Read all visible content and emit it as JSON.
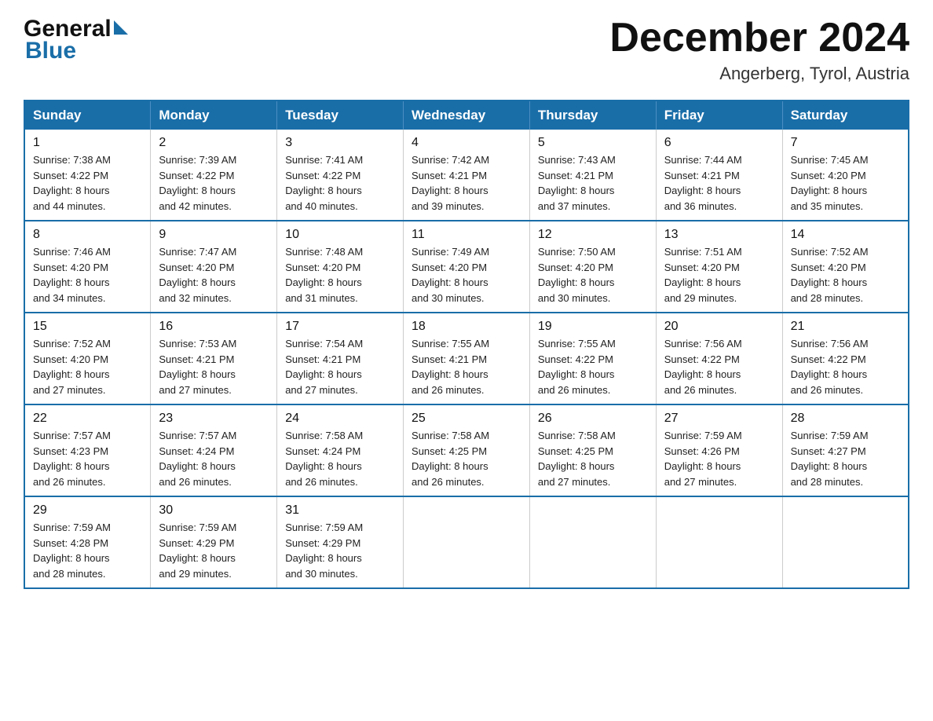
{
  "header": {
    "logo_general": "General",
    "logo_blue": "Blue",
    "month_title": "December 2024",
    "location": "Angerberg, Tyrol, Austria"
  },
  "days_of_week": [
    "Sunday",
    "Monday",
    "Tuesday",
    "Wednesday",
    "Thursday",
    "Friday",
    "Saturday"
  ],
  "weeks": [
    [
      {
        "day": "1",
        "sunrise": "7:38 AM",
        "sunset": "4:22 PM",
        "daylight": "8 hours and 44 minutes."
      },
      {
        "day": "2",
        "sunrise": "7:39 AM",
        "sunset": "4:22 PM",
        "daylight": "8 hours and 42 minutes."
      },
      {
        "day": "3",
        "sunrise": "7:41 AM",
        "sunset": "4:22 PM",
        "daylight": "8 hours and 40 minutes."
      },
      {
        "day": "4",
        "sunrise": "7:42 AM",
        "sunset": "4:21 PM",
        "daylight": "8 hours and 39 minutes."
      },
      {
        "day": "5",
        "sunrise": "7:43 AM",
        "sunset": "4:21 PM",
        "daylight": "8 hours and 37 minutes."
      },
      {
        "day": "6",
        "sunrise": "7:44 AM",
        "sunset": "4:21 PM",
        "daylight": "8 hours and 36 minutes."
      },
      {
        "day": "7",
        "sunrise": "7:45 AM",
        "sunset": "4:20 PM",
        "daylight": "8 hours and 35 minutes."
      }
    ],
    [
      {
        "day": "8",
        "sunrise": "7:46 AM",
        "sunset": "4:20 PM",
        "daylight": "8 hours and 34 minutes."
      },
      {
        "day": "9",
        "sunrise": "7:47 AM",
        "sunset": "4:20 PM",
        "daylight": "8 hours and 32 minutes."
      },
      {
        "day": "10",
        "sunrise": "7:48 AM",
        "sunset": "4:20 PM",
        "daylight": "8 hours and 31 minutes."
      },
      {
        "day": "11",
        "sunrise": "7:49 AM",
        "sunset": "4:20 PM",
        "daylight": "8 hours and 30 minutes."
      },
      {
        "day": "12",
        "sunrise": "7:50 AM",
        "sunset": "4:20 PM",
        "daylight": "8 hours and 30 minutes."
      },
      {
        "day": "13",
        "sunrise": "7:51 AM",
        "sunset": "4:20 PM",
        "daylight": "8 hours and 29 minutes."
      },
      {
        "day": "14",
        "sunrise": "7:52 AM",
        "sunset": "4:20 PM",
        "daylight": "8 hours and 28 minutes."
      }
    ],
    [
      {
        "day": "15",
        "sunrise": "7:52 AM",
        "sunset": "4:20 PM",
        "daylight": "8 hours and 27 minutes."
      },
      {
        "day": "16",
        "sunrise": "7:53 AM",
        "sunset": "4:21 PM",
        "daylight": "8 hours and 27 minutes."
      },
      {
        "day": "17",
        "sunrise": "7:54 AM",
        "sunset": "4:21 PM",
        "daylight": "8 hours and 27 minutes."
      },
      {
        "day": "18",
        "sunrise": "7:55 AM",
        "sunset": "4:21 PM",
        "daylight": "8 hours and 26 minutes."
      },
      {
        "day": "19",
        "sunrise": "7:55 AM",
        "sunset": "4:22 PM",
        "daylight": "8 hours and 26 minutes."
      },
      {
        "day": "20",
        "sunrise": "7:56 AM",
        "sunset": "4:22 PM",
        "daylight": "8 hours and 26 minutes."
      },
      {
        "day": "21",
        "sunrise": "7:56 AM",
        "sunset": "4:22 PM",
        "daylight": "8 hours and 26 minutes."
      }
    ],
    [
      {
        "day": "22",
        "sunrise": "7:57 AM",
        "sunset": "4:23 PM",
        "daylight": "8 hours and 26 minutes."
      },
      {
        "day": "23",
        "sunrise": "7:57 AM",
        "sunset": "4:24 PM",
        "daylight": "8 hours and 26 minutes."
      },
      {
        "day": "24",
        "sunrise": "7:58 AM",
        "sunset": "4:24 PM",
        "daylight": "8 hours and 26 minutes."
      },
      {
        "day": "25",
        "sunrise": "7:58 AM",
        "sunset": "4:25 PM",
        "daylight": "8 hours and 26 minutes."
      },
      {
        "day": "26",
        "sunrise": "7:58 AM",
        "sunset": "4:25 PM",
        "daylight": "8 hours and 27 minutes."
      },
      {
        "day": "27",
        "sunrise": "7:59 AM",
        "sunset": "4:26 PM",
        "daylight": "8 hours and 27 minutes."
      },
      {
        "day": "28",
        "sunrise": "7:59 AM",
        "sunset": "4:27 PM",
        "daylight": "8 hours and 28 minutes."
      }
    ],
    [
      {
        "day": "29",
        "sunrise": "7:59 AM",
        "sunset": "4:28 PM",
        "daylight": "8 hours and 28 minutes."
      },
      {
        "day": "30",
        "sunrise": "7:59 AM",
        "sunset": "4:29 PM",
        "daylight": "8 hours and 29 minutes."
      },
      {
        "day": "31",
        "sunrise": "7:59 AM",
        "sunset": "4:29 PM",
        "daylight": "8 hours and 30 minutes."
      },
      null,
      null,
      null,
      null
    ]
  ],
  "labels": {
    "sunrise": "Sunrise:",
    "sunset": "Sunset:",
    "daylight": "Daylight:"
  }
}
